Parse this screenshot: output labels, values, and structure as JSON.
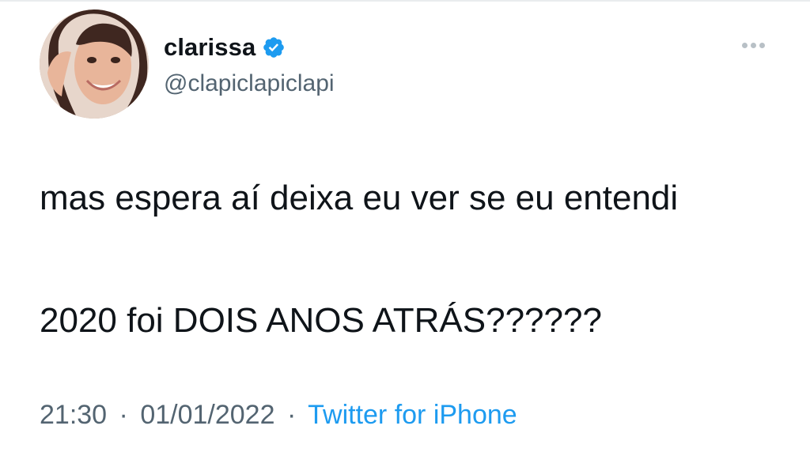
{
  "user": {
    "display_name": "clarissa",
    "handle": "@clapiclapiclapi",
    "verified_icon": "verified-badge-icon",
    "avatar": "profile-photo"
  },
  "more_button": {
    "icon": "more-options-icon"
  },
  "tweet": {
    "line1": "mas espera aí deixa eu ver se eu entendi",
    "line2": "2020 foi DOIS ANOS ATRÁS??????"
  },
  "meta": {
    "time": "21:30",
    "separator": "·",
    "date": "01/01/2022",
    "source": "Twitter for iPhone"
  },
  "colors": {
    "text": "#0f1419",
    "muted": "#536471",
    "link": "#1d9bf0",
    "verified": "#1d9bf0"
  }
}
